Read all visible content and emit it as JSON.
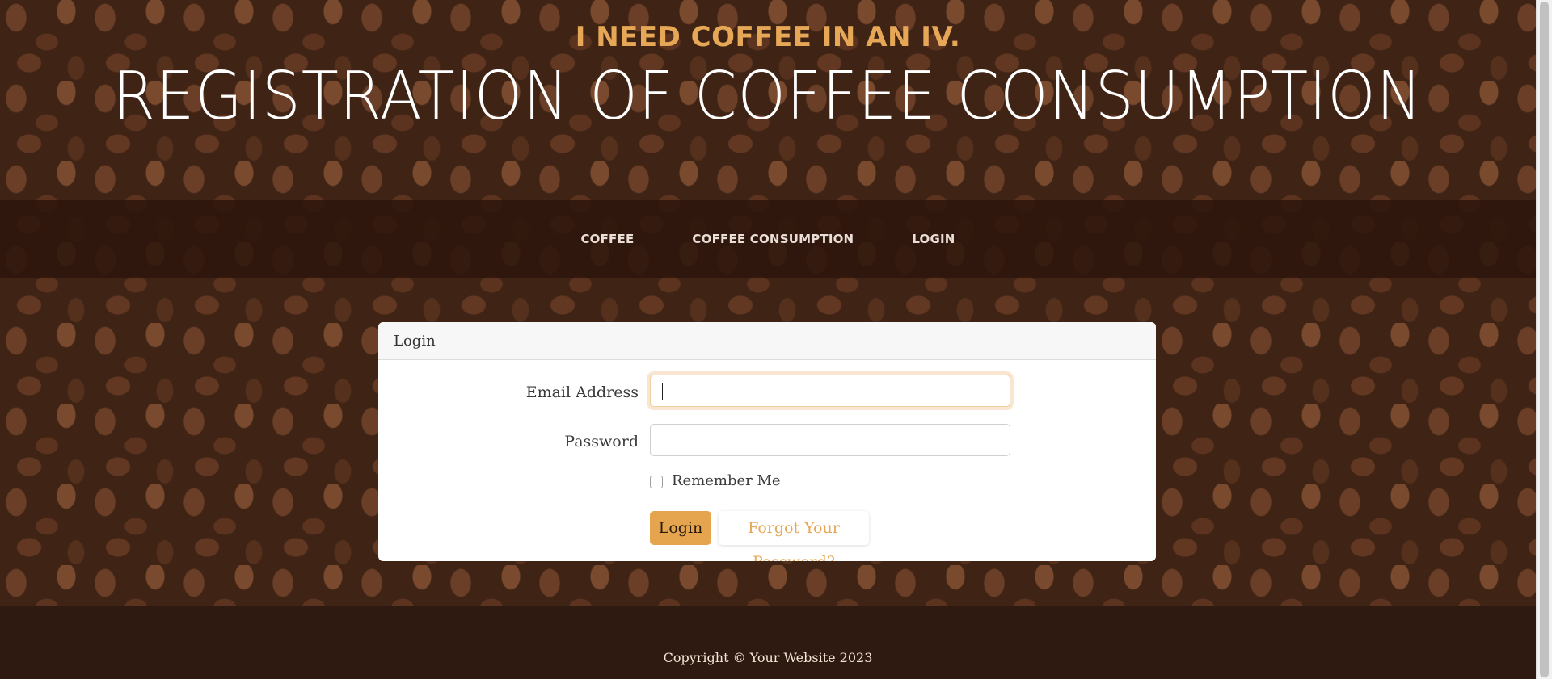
{
  "header": {
    "subheading": "I NEED COFFEE IN AN IV.",
    "heading": "REGISTRATION OF COFFEE CONSUMPTION"
  },
  "nav": {
    "items": [
      {
        "label": "COFFEE"
      },
      {
        "label": "COFFEE CONSUMPTION"
      },
      {
        "label": "LOGIN"
      }
    ]
  },
  "login_card": {
    "title": "Login",
    "email_label": "Email Address",
    "email_value": "",
    "password_label": "Password",
    "password_value": "",
    "remember_label": "Remember Me",
    "remember_checked": false,
    "login_button": "Login",
    "forgot_link": "Forgot Your Password?"
  },
  "footer": {
    "copyright": "Copyright © Your Website 2023"
  },
  "colors": {
    "accent": "#e6a756",
    "nav_bg": "#2d160c",
    "footer_bg": "#2e1a10"
  }
}
